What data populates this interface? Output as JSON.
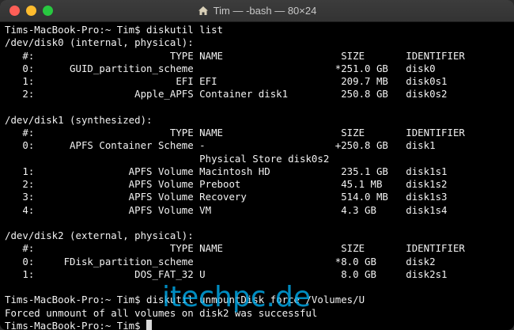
{
  "window": {
    "title": "Tim — -bash — 80×24"
  },
  "terminal": {
    "lines": [
      "Tims-MacBook-Pro:~ Tim$ diskutil list",
      "/dev/disk0 (internal, physical):",
      "   #:                       TYPE NAME                    SIZE       IDENTIFIER",
      "   0:      GUID_partition_scheme                        *251.0 GB   disk0",
      "   1:                        EFI EFI                     209.7 MB   disk0s1",
      "   2:                 Apple_APFS Container disk1         250.8 GB   disk0s2",
      "",
      "/dev/disk1 (synthesized):",
      "   #:                       TYPE NAME                    SIZE       IDENTIFIER",
      "   0:      APFS Container Scheme -                      +250.8 GB   disk1",
      "                                 Physical Store disk0s2",
      "   1:                APFS Volume Macintosh HD            235.1 GB   disk1s1",
      "   2:                APFS Volume Preboot                 45.1 MB    disk1s2",
      "   3:                APFS Volume Recovery                514.0 MB   disk1s3",
      "   4:                APFS Volume VM                      4.3 GB     disk1s4",
      "",
      "/dev/disk2 (external, physical):",
      "   #:                       TYPE NAME                    SIZE       IDENTIFIER",
      "   0:     FDisk_partition_scheme                        *8.0 GB     disk2",
      "   1:                 DOS_FAT_32 U                       8.0 GB     disk2s1",
      "",
      "Tims-MacBook-Pro:~ Tim$ diskutil unmountDisk force /Volumes/U",
      "Forced unmount of all volumes on disk2 was successful"
    ],
    "prompt": "Tims-MacBook-Pro:~ Tim$ "
  },
  "watermark": {
    "text": "itechpc.de"
  }
}
